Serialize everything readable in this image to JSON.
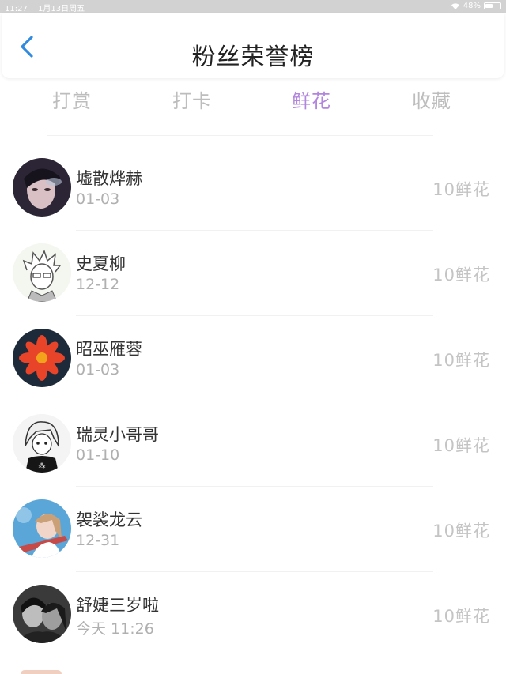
{
  "status": {
    "time": "11:27",
    "date": "1月13日周五",
    "battery": "48%",
    "battery_level": 0.48
  },
  "header": {
    "title": "粉丝荣誉榜"
  },
  "tabs": [
    {
      "label": "打赏",
      "active": false
    },
    {
      "label": "打卡",
      "active": false
    },
    {
      "label": "鲜花",
      "active": true
    },
    {
      "label": "收藏",
      "active": false
    }
  ],
  "colors": {
    "accent": "#b286dd",
    "back_icon": "#2f8ae0",
    "inactive_tab": "#bdbdbd"
  },
  "list": [
    {
      "name": "墟散烨赫",
      "date": "01-03",
      "amount": "10鲜花",
      "avatar": "dark-portrait-avatar"
    },
    {
      "name": "史夏柳",
      "date": "12-12",
      "amount": "10鲜花",
      "avatar": "sketch-character-avatar"
    },
    {
      "name": "昭巫雁蓉",
      "date": "01-03",
      "amount": "10鲜花",
      "avatar": "red-flower-avatar"
    },
    {
      "name": "瑞灵小哥哥",
      "date": "01-10",
      "amount": "10鲜花",
      "avatar": "anime-character-avatar"
    },
    {
      "name": "袈裟龙云",
      "date": "12-31",
      "amount": "10鲜花",
      "avatar": "girl-blue-background-avatar"
    },
    {
      "name": "舒婕三岁啦",
      "date": "今天 11:26",
      "amount": "10鲜花",
      "avatar": "couple-photo-avatar"
    }
  ]
}
